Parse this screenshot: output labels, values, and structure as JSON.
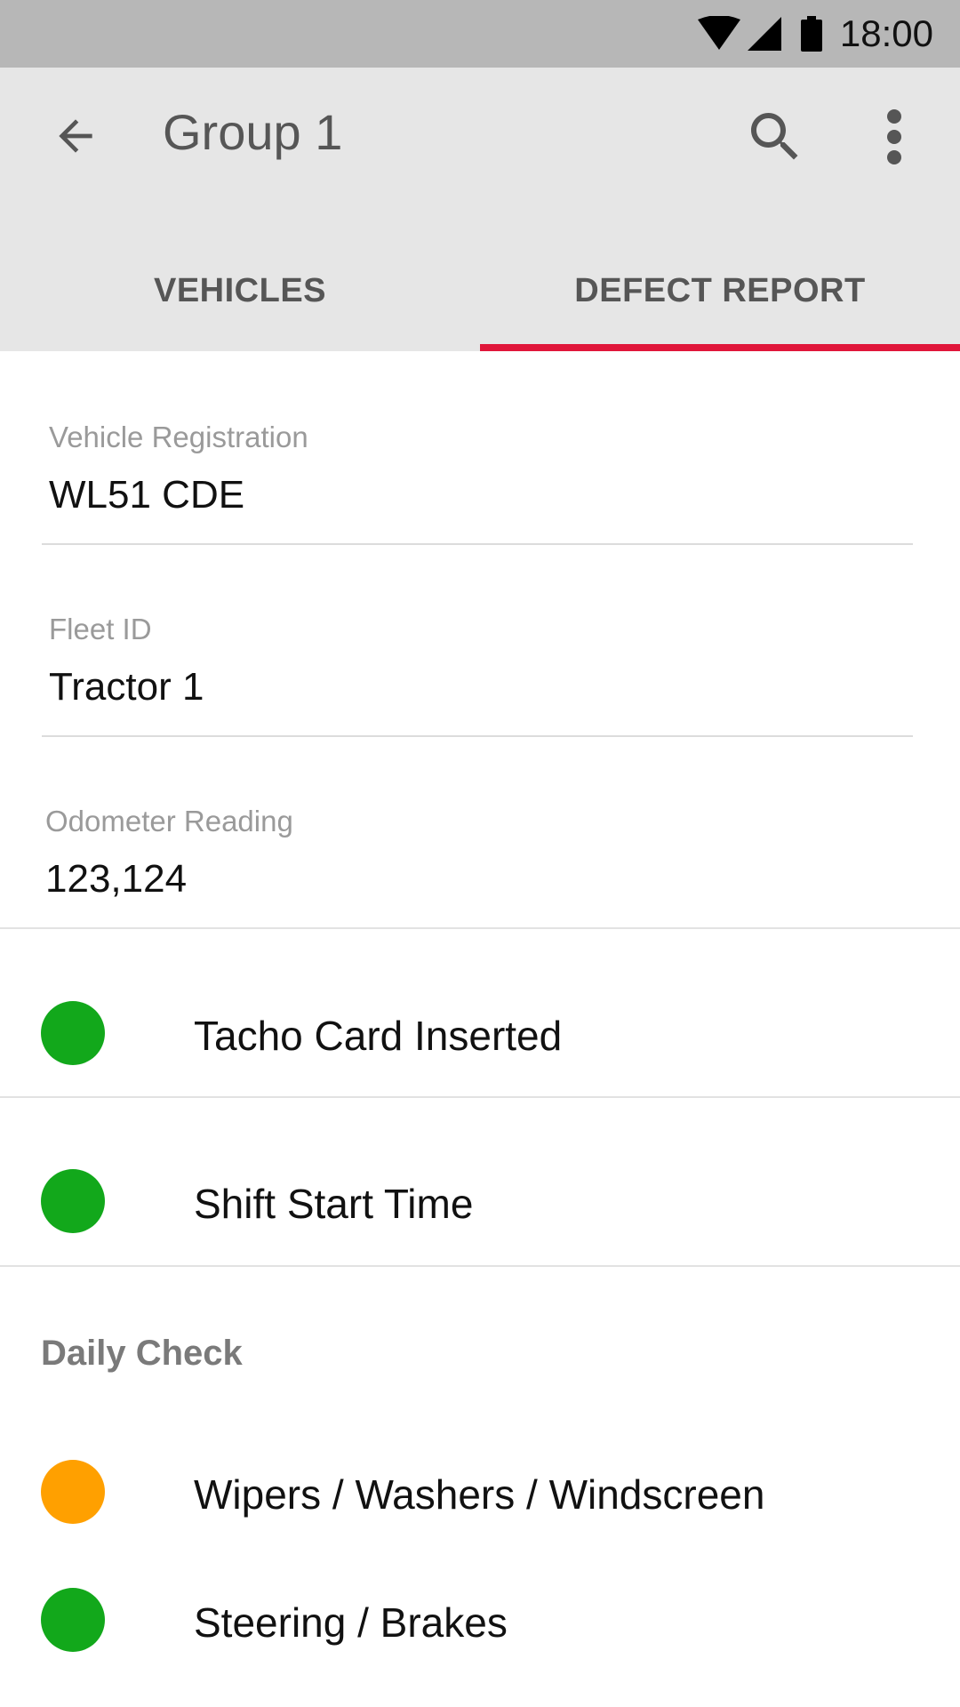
{
  "status_bar": {
    "time": "18:00",
    "icons": [
      "wifi-icon",
      "signal-icon",
      "battery-icon"
    ]
  },
  "app_bar": {
    "back_icon": "arrow-back-icon",
    "title": "Group 1",
    "search_icon": "search-icon",
    "more_icon": "more-vert-icon",
    "background": "#e6e6e6"
  },
  "tabs": [
    {
      "label": "VEHICLES",
      "active": false
    },
    {
      "label": "DEFECT REPORT",
      "active": true
    }
  ],
  "accent_color": "#e0163a",
  "form": {
    "vehicle_registration": {
      "label": "Vehicle Registration",
      "value": "WL51 CDE"
    },
    "fleet_id": {
      "label": "Fleet ID",
      "value": "Tractor 1"
    },
    "odometer": {
      "label": "Odometer Reading",
      "value": "123,124"
    }
  },
  "status_rows": [
    {
      "label": "Tacho Card Inserted",
      "status": "ok",
      "color": "#12a81b"
    },
    {
      "label": "Shift Start Time",
      "status": "ok",
      "color": "#12a81b"
    }
  ],
  "daily_check": {
    "header": "Daily Check",
    "items": [
      {
        "label": "Wipers / Washers / Windscreen",
        "status": "warning",
        "color": "#ffa000"
      },
      {
        "label": "Steering / Brakes",
        "status": "ok",
        "color": "#12a81b"
      }
    ]
  }
}
